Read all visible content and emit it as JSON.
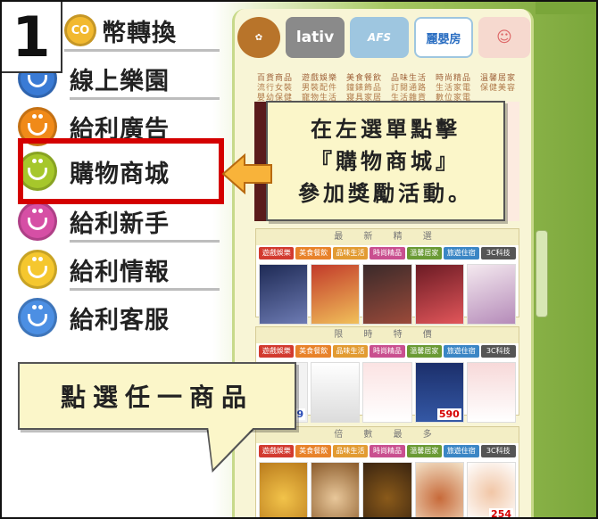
{
  "step": {
    "number": "1"
  },
  "menu": {
    "items": [
      {
        "badge": "CO",
        "label": "幣轉換",
        "color": "#f2b92f"
      },
      {
        "badge": "",
        "label": "線上樂園",
        "color": "#3a7bd5"
      },
      {
        "badge": "",
        "label": "給利廣告",
        "color": "#f08a19"
      },
      {
        "badge": "",
        "label": "購物商城",
        "color": "#a6c72b"
      },
      {
        "badge": "",
        "label": "給利新手",
        "color": "#d64fa5"
      },
      {
        "badge": "",
        "label": "給利情報",
        "color": "#f5c72e"
      },
      {
        "badge": "",
        "label": "給利客服",
        "color": "#4c8fe3"
      }
    ],
    "highlight_color": "#d40000"
  },
  "callouts": {
    "instruction_1": "在左選單點擊『購物商城』參加獎勵活動。",
    "instruction_1_lines": [
      "在左選單點擊",
      "『購物商城』",
      "參加獎勵活動。"
    ],
    "instruction_2": "點選任一商品"
  },
  "store": {
    "logos": [
      "lativ",
      "AFS",
      "麗嬰房"
    ],
    "category_nav": [
      "百貨商品　遊戲娛樂　美食餐飲　品味生活　時尚精品　溫馨居家　旅遊住宿　3C科技",
      "流行女裝　男裝配件　鐘錶飾品　訂閱通路　生活家電　保健美容　　購物書店",
      "嬰幼保健　寵物生活　寢具家居　生活雜貨　數位家電　　　　　　　運動休閒"
    ],
    "sections": [
      {
        "title": "最 新 精 選"
      },
      {
        "title": "限 時 特 價"
      },
      {
        "title": "倍 數 最 多"
      }
    ],
    "tabs": [
      "遊戲娛樂",
      "美食餐飲",
      "品味生活",
      "時尚精品",
      "溫馨居家",
      "旅遊住宿",
      "3C科技"
    ],
    "prices": [
      "999",
      "590",
      "254"
    ],
    "colors": {
      "accent_green": "#7aa63a",
      "tab_red": "#d23a2f"
    }
  }
}
